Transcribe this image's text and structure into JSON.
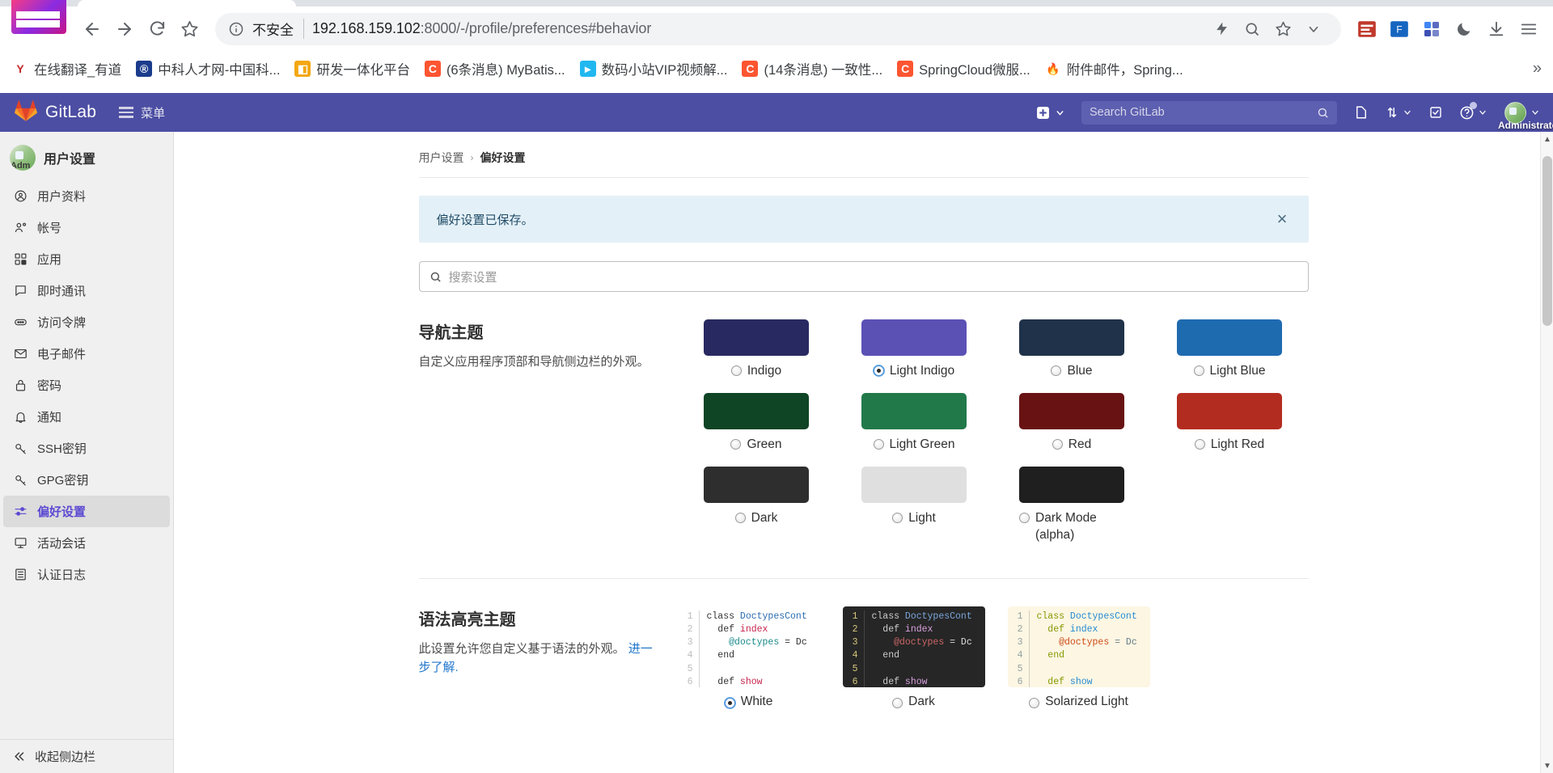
{
  "browser": {
    "nav": {
      "back_label": "back-arrow",
      "forward_label": "forward-arrow",
      "reload_label": "reload",
      "bookmark_label": "star"
    },
    "omnibox": {
      "security_label": "不安全",
      "url_host": "192.168.159.102",
      "url_rest": ":8000/-/profile/preferences#behavior"
    },
    "bookmarks": [
      {
        "label": "在线翻译_有道",
        "favicon": "Y",
        "color": "#ffffff",
        "fg": "#c62828"
      },
      {
        "label": "中科人才网-中国科...",
        "favicon": "®",
        "color": "#1b3c8c",
        "fg": "#ffffff"
      },
      {
        "label": "研发一体化平台",
        "favicon": "◧",
        "color": "#f3a712",
        "fg": "#ffffff"
      },
      {
        "label": "(6条消息) MyBatis...",
        "favicon": "C",
        "color": "#fc5531",
        "fg": "#ffffff"
      },
      {
        "label": "数码小站VIP视频解...",
        "favicon": "▸",
        "color": "#21b8f0",
        "fg": "#ffffff"
      },
      {
        "label": "(14条消息) 一致性...",
        "favicon": "C",
        "color": "#fc5531",
        "fg": "#ffffff"
      },
      {
        "label": "SpringCloud微服...",
        "favicon": "C",
        "color": "#fc5531",
        "fg": "#ffffff"
      },
      {
        "label": "附件邮件，Spring...",
        "favicon": "🔥",
        "color": "#ffffff",
        "fg": "#e8453c"
      }
    ],
    "bookmarks_overflow": "»"
  },
  "gitlab": {
    "brand": "GitLab",
    "menu_label": "菜单",
    "search_placeholder": "Search GitLab",
    "user_name": "Administrator",
    "navbar_color": "#4c4ea3",
    "icons": {
      "plus": "plus-square-icon",
      "issues": "issues-icon",
      "merge_requests": "merge-request-icon",
      "todos": "todo-icon",
      "help": "help-icon"
    }
  },
  "sidebar": {
    "title": "用户设置",
    "avatar_initials": "Adm",
    "items": [
      {
        "label": "用户资料",
        "icon": "profile-icon",
        "active": false
      },
      {
        "label": "帐号",
        "icon": "account-icon",
        "active": false
      },
      {
        "label": "应用",
        "icon": "applications-icon",
        "active": false
      },
      {
        "label": "即时通讯",
        "icon": "chat-icon",
        "active": false
      },
      {
        "label": "访问令牌",
        "icon": "token-icon",
        "active": false
      },
      {
        "label": "电子邮件",
        "icon": "mail-icon",
        "active": false
      },
      {
        "label": "密码",
        "icon": "lock-icon",
        "active": false
      },
      {
        "label": "通知",
        "icon": "bell-icon",
        "active": false
      },
      {
        "label": "SSH密钥",
        "icon": "key-icon",
        "active": false
      },
      {
        "label": "GPG密钥",
        "icon": "key-icon",
        "active": false
      },
      {
        "label": "偏好设置",
        "icon": "preferences-icon",
        "active": true
      },
      {
        "label": "活动会话",
        "icon": "monitor-icon",
        "active": false
      },
      {
        "label": "认证日志",
        "icon": "log-icon",
        "active": false
      }
    ],
    "collapse_label": "收起侧边栏"
  },
  "main": {
    "breadcrumb": {
      "parent": "用户设置",
      "separator": "›",
      "current": "偏好设置"
    },
    "alert": {
      "message": "偏好设置已保存。",
      "close_label": "×"
    },
    "settings_search_placeholder": "搜索设置",
    "nav_theme": {
      "title": "导航主题",
      "description": "自定义应用程序顶部和导航侧边栏的外观。",
      "options": [
        {
          "label": "Indigo",
          "color": "#292961",
          "checked": false
        },
        {
          "label": "Light Indigo",
          "color": "#5b51b5",
          "checked": true
        },
        {
          "label": "Blue",
          "color": "#1f3249",
          "checked": false
        },
        {
          "label": "Light Blue",
          "color": "#1f6bb0",
          "checked": false
        },
        {
          "label": "Green",
          "color": "#0f4425",
          "checked": false
        },
        {
          "label": "Light Green",
          "color": "#21794a",
          "checked": false
        },
        {
          "label": "Red",
          "color": "#691213",
          "checked": false
        },
        {
          "label": "Light Red",
          "color": "#b32c20",
          "checked": false
        },
        {
          "label": "Dark",
          "color": "#2e2e2e",
          "checked": false
        },
        {
          "label": "Light",
          "color": "#dfdfdf",
          "checked": false
        },
        {
          "label": "Dark Mode (alpha)",
          "color": "#1f1f1f",
          "checked": false
        }
      ]
    },
    "syntax_theme": {
      "title": "语法高亮主题",
      "description": "此设置允许您自定义基于语法的外观。",
      "link_text": "进一步了解.",
      "code_lines": [
        "1",
        "2",
        "3",
        "4",
        "5",
        "6"
      ],
      "code_snippet": [
        {
          "text": "class ",
          "t": "kw"
        },
        {
          "text": "DoctypesCont",
          "t": "cls"
        }
      ],
      "options": [
        {
          "label": "White",
          "checked": true,
          "bg": "#ffffff",
          "gutter": "#bdbdbd",
          "fg": "#333333"
        },
        {
          "label": "Dark",
          "checked": false,
          "bg": "#262626",
          "gutter": "#d6c77c",
          "fg": "#e0e0e0"
        },
        {
          "label": "Solarized Light",
          "checked": false,
          "bg": "#fdf6e3",
          "gutter": "#93a1a1",
          "fg": "#657b83"
        }
      ],
      "preview_code": {
        "l1a": "class ",
        "l1b": "DoctypesCont",
        "l2a": "  def ",
        "l2b": "index",
        "l3a": "    @doctypes",
        "l3b": " = Dc",
        "l4": "  end",
        "l5": "",
        "l6a": "  def ",
        "l6b": "show"
      }
    }
  }
}
